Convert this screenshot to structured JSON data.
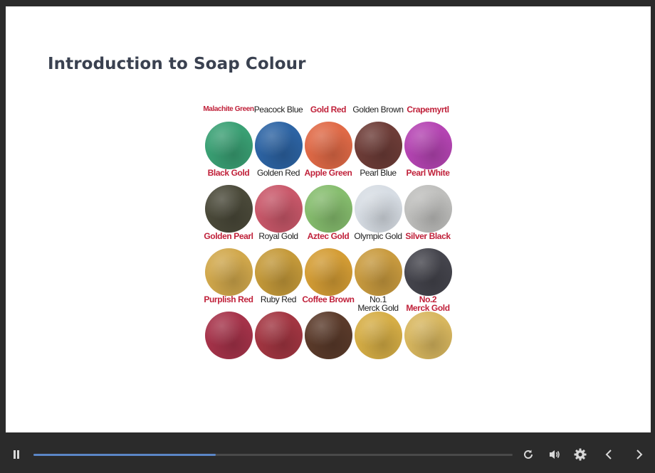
{
  "slide": {
    "title": "Introduction to Soap Colour",
    "swatches": [
      {
        "label": "Malachite Green",
        "label_color": "red",
        "small": true,
        "color": "#3aa074"
      },
      {
        "label": "Peacock Blue",
        "label_color": "black",
        "color": "#2d64a4"
      },
      {
        "label": "Gold Red",
        "label_color": "red",
        "color": "#e06a47"
      },
      {
        "label": "Golden Brown",
        "label_color": "black",
        "color": "#6e3d38"
      },
      {
        "label": "Crapemyrtl",
        "label_color": "red",
        "color": "#b545b3"
      },
      {
        "label": "Black Gold",
        "label_color": "red",
        "color": "#4b4a3a"
      },
      {
        "label": "Golden Red",
        "label_color": "black",
        "color": "#c9586a"
      },
      {
        "label": "Apple Green",
        "label_color": "red",
        "color": "#86bd6e"
      },
      {
        "label": "Pearl Blue",
        "label_color": "black",
        "color": "#d7dde4"
      },
      {
        "label": "Pearl White",
        "label_color": "red",
        "color": "#bfbfbd"
      },
      {
        "label": "Golden Pearl",
        "label_color": "red",
        "color": "#d1a84c"
      },
      {
        "label": "Royal Gold",
        "label_color": "black",
        "color": "#c59a3a"
      },
      {
        "label": "Aztec Gold",
        "label_color": "red",
        "color": "#d49d35"
      },
      {
        "label": "Olympic Gold",
        "label_color": "black",
        "color": "#c99b3f"
      },
      {
        "label": "Silver Black",
        "label_color": "red",
        "color": "#45454d"
      },
      {
        "label": "Purplish Red",
        "label_color": "red",
        "color": "#a6334a"
      },
      {
        "label": "Ruby Red",
        "label_color": "black",
        "color": "#a33642"
      },
      {
        "label": "Coffee Brown",
        "label_color": "red",
        "color": "#5b3b2b"
      },
      {
        "label": "No.1\nMerck Gold",
        "label_color": "black",
        "color": "#d6ae46"
      },
      {
        "label": "No.2\nMerck Gold",
        "label_color": "red",
        "color": "#d8b75f"
      }
    ]
  },
  "player": {
    "progress": 0.38,
    "accent_color": "#5b86c6",
    "icons": {
      "pause": "pause-icon",
      "replay": "replay-icon",
      "volume": "volume-icon",
      "settings": "gear-icon",
      "prev": "chevron-left-icon",
      "next": "chevron-right-icon"
    }
  }
}
